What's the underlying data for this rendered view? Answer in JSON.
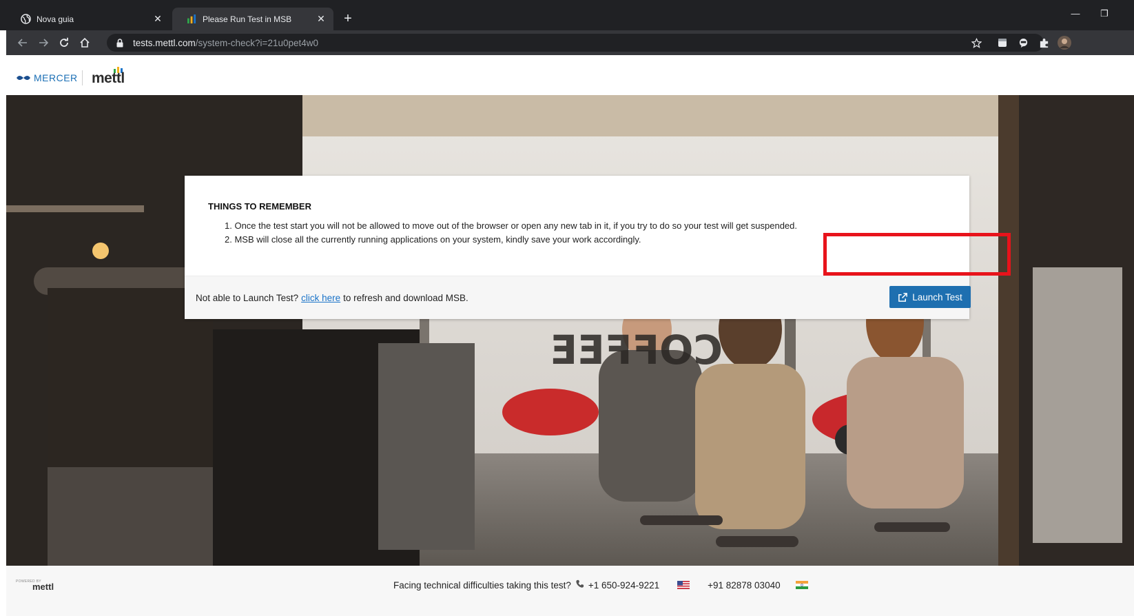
{
  "browser": {
    "tabs": [
      {
        "title": "Nova guia",
        "favicon": "globe-icon",
        "active": false
      },
      {
        "title": "Please Run Test in MSB",
        "favicon": "mettl-favicon",
        "active": true
      }
    ],
    "url_host": "tests.mettl.com",
    "url_path": "/system-check?i=21u0pet4w0"
  },
  "header": {
    "mercer_logo": "MERCER",
    "mettl_logo": "mettl"
  },
  "card": {
    "title": "THINGS TO REMEMBER",
    "rules": [
      "1. Once the test start you will not be allowed to move out of the browser or open any new tab in it, if you try to do so your test will get suspended.",
      "2. MSB will close all the currently running applications on your system, kindly save your work accordingly."
    ],
    "footer_prefix": "Not able to Launch Test?",
    "footer_link": "click here",
    "footer_suffix": "to refresh and download MSB.",
    "launch_label": "Launch Test"
  },
  "footer": {
    "powered_by": "POWERED BY",
    "powered_logo": "mettl",
    "help_text": "Facing technical difficulties taking this test?",
    "phone_us": "+1 650-924-9221",
    "phone_in": "+91 82878 03040"
  },
  "colors": {
    "accent": "#1e6fb0",
    "highlight": "#e8131b",
    "chrome_dark": "#202124"
  }
}
